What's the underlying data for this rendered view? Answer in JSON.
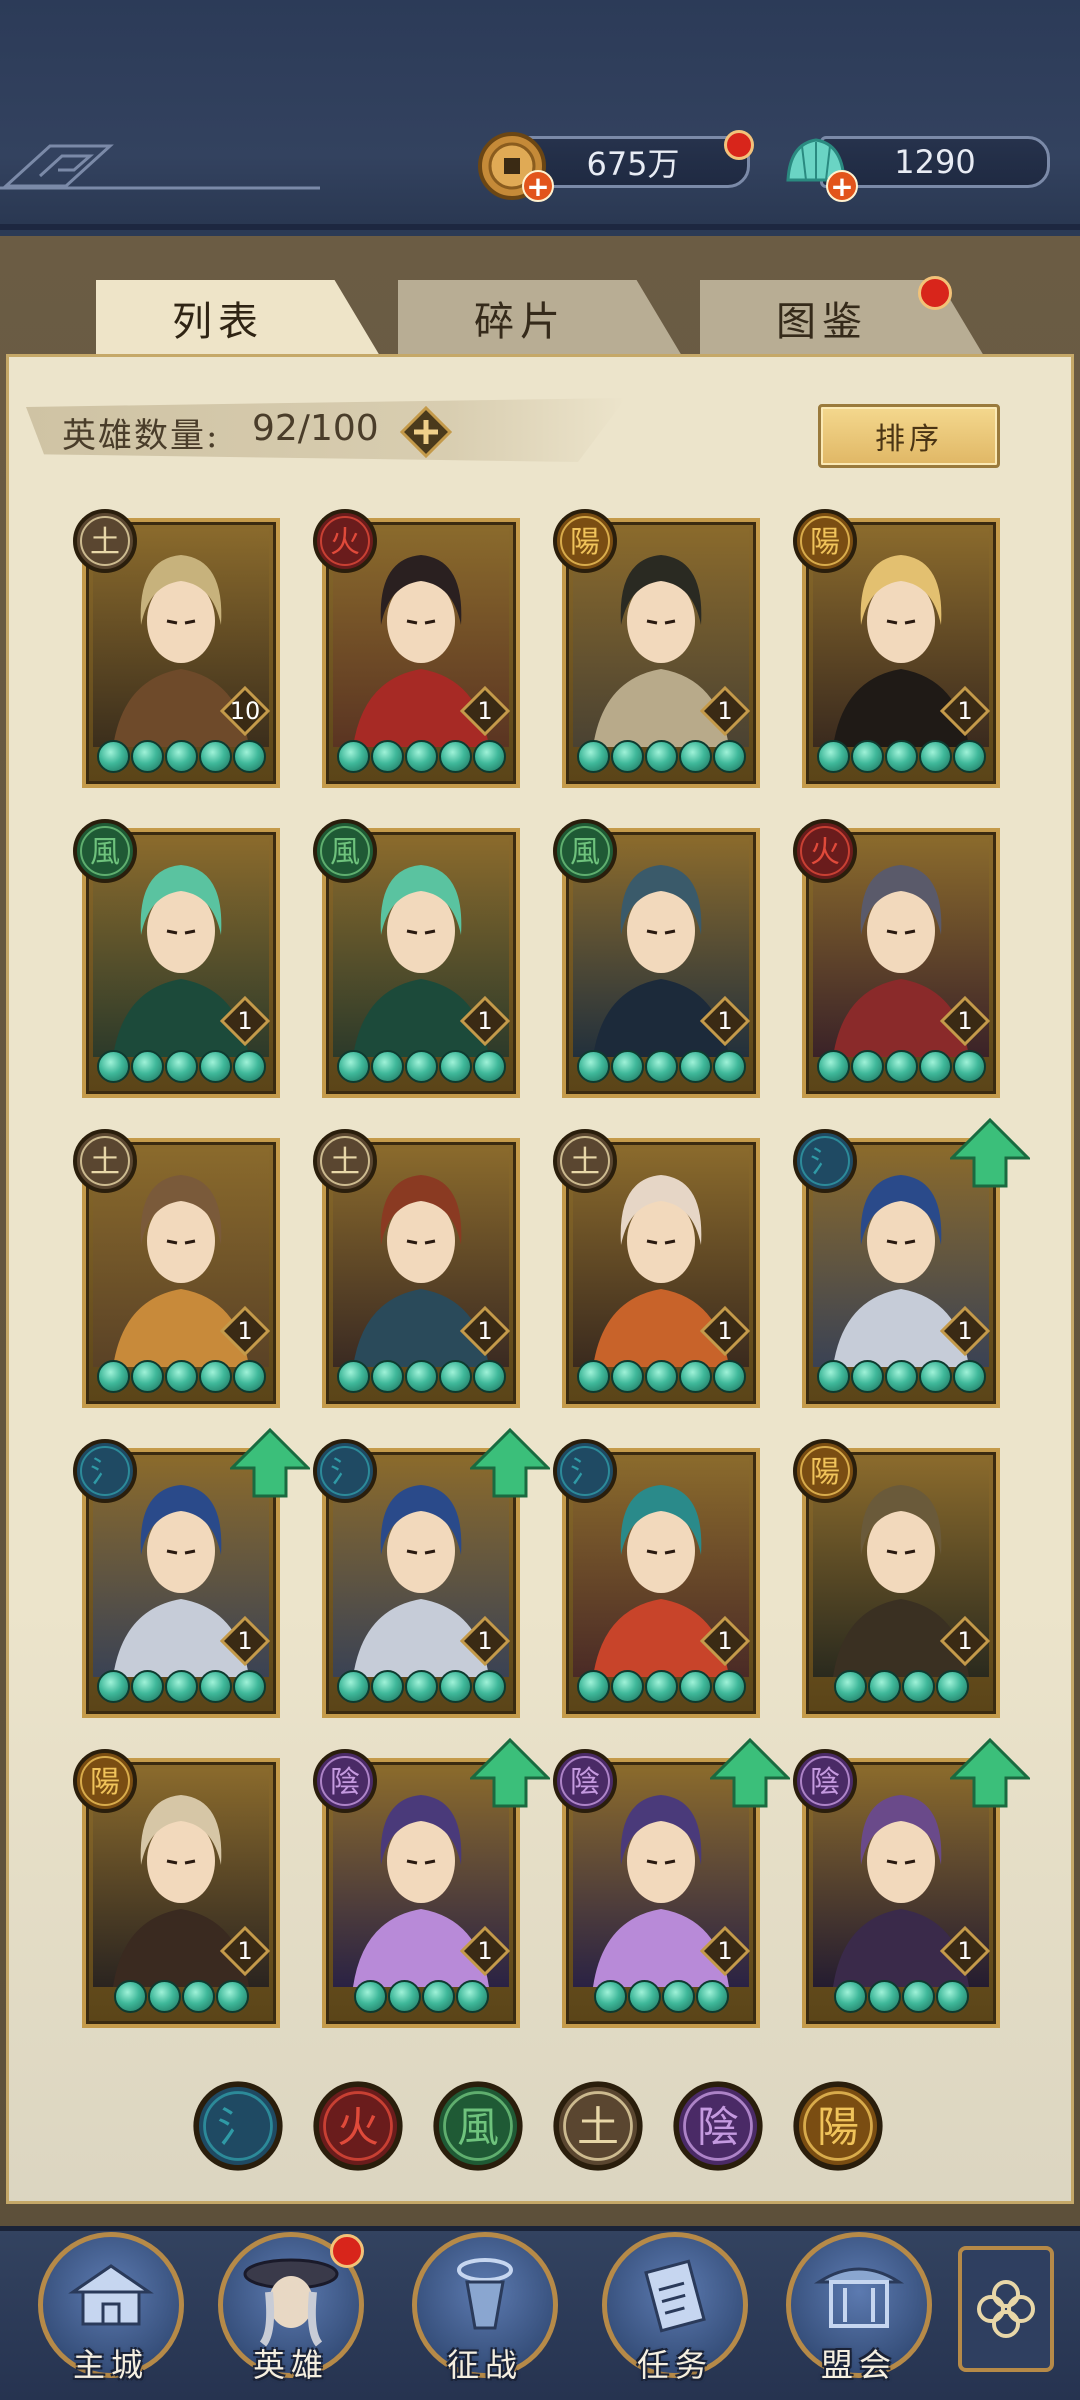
{
  "resources": {
    "copper": {
      "value": "675万",
      "icon": "copper-coin-icon"
    },
    "jade": {
      "value": "1290",
      "icon": "jade-shell-icon"
    }
  },
  "tabs": [
    {
      "label": "列表",
      "active": true
    },
    {
      "label": "碎片",
      "active": false
    },
    {
      "label": "图鉴",
      "active": false,
      "badge": true
    }
  ],
  "hero_count": {
    "label": "英雄数量:",
    "value": "92/100"
  },
  "sort_label": "排序",
  "elements": {
    "water": {
      "glyph": "氵",
      "color": "#2f9aa6",
      "bg": "#1f4a63"
    },
    "fire": {
      "glyph": "火",
      "color": "#e04a3a",
      "bg": "#6a1c1c"
    },
    "wind": {
      "glyph": "風",
      "color": "#6fc37d",
      "bg": "#1f5a35"
    },
    "earth": {
      "glyph": "土",
      "color": "#e8d7a8",
      "bg": "#5a4630"
    },
    "yin": {
      "glyph": "陰",
      "color": "#c59ae0",
      "bg": "#4a2a66"
    },
    "yang": {
      "glyph": "陽",
      "color": "#f0c35a",
      "bg": "#7a4d12"
    }
  },
  "heroes": [
    {
      "element": "earth",
      "level": "10",
      "stars": 5,
      "up": false
    },
    {
      "element": "fire",
      "level": "1",
      "stars": 5,
      "up": false
    },
    {
      "element": "yang",
      "level": "1",
      "stars": 5,
      "up": false
    },
    {
      "element": "yang",
      "level": "1",
      "stars": 5,
      "up": false
    },
    {
      "element": "wind",
      "level": "1",
      "stars": 5,
      "up": false
    },
    {
      "element": "wind",
      "level": "1",
      "stars": 5,
      "up": false
    },
    {
      "element": "wind",
      "level": "1",
      "stars": 5,
      "up": false
    },
    {
      "element": "fire",
      "level": "1",
      "stars": 5,
      "up": false
    },
    {
      "element": "earth",
      "level": "1",
      "stars": 5,
      "up": false
    },
    {
      "element": "earth",
      "level": "1",
      "stars": 5,
      "up": false
    },
    {
      "element": "earth",
      "level": "1",
      "stars": 5,
      "up": false
    },
    {
      "element": "water",
      "level": "1",
      "stars": 5,
      "up": true
    },
    {
      "element": "water",
      "level": "1",
      "stars": 5,
      "up": true
    },
    {
      "element": "water",
      "level": "1",
      "stars": 5,
      "up": true
    },
    {
      "element": "water",
      "level": "1",
      "stars": 5,
      "up": false
    },
    {
      "element": "yang",
      "level": "1",
      "stars": 4,
      "up": false
    },
    {
      "element": "yang",
      "level": "1",
      "stars": 4,
      "up": false
    },
    {
      "element": "yin",
      "level": "1",
      "stars": 4,
      "up": true
    },
    {
      "element": "yin",
      "level": "1",
      "stars": 4,
      "up": true
    },
    {
      "element": "yin",
      "level": "1",
      "stars": 4,
      "up": true
    }
  ],
  "filters": [
    "water",
    "fire",
    "wind",
    "earth",
    "yin",
    "yang"
  ],
  "nav": [
    {
      "label": "主城",
      "icon": "city-gate-icon"
    },
    {
      "label": "英雄",
      "icon": "hero-portrait-icon",
      "badge": true
    },
    {
      "label": "征战",
      "icon": "battle-icon"
    },
    {
      "label": "任务",
      "icon": "scroll-task-icon"
    },
    {
      "label": "盟会",
      "icon": "alliance-pavilion-icon"
    }
  ],
  "menu_icon": "clover-menu-icon"
}
